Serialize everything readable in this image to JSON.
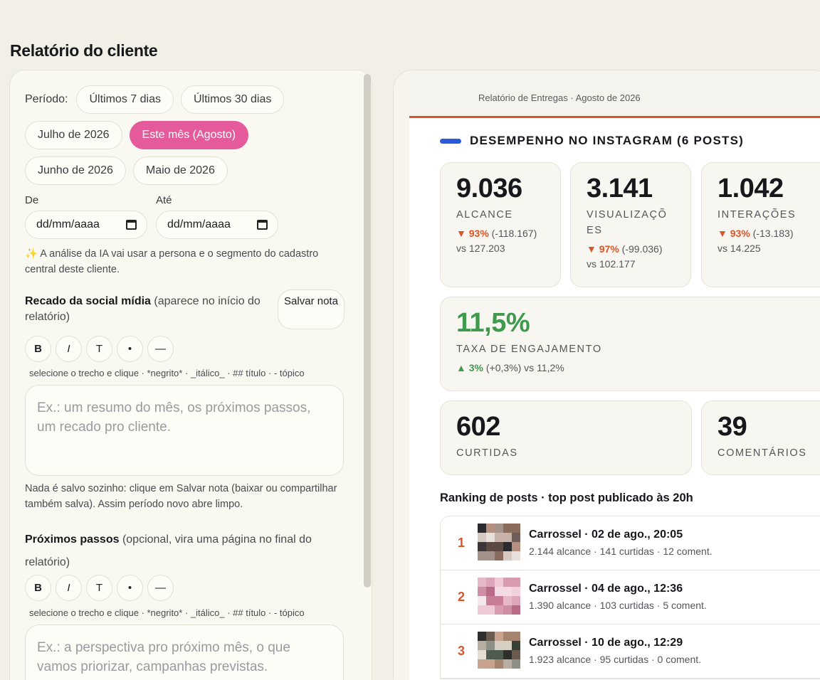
{
  "page_title": "Relatório do cliente",
  "period": {
    "label": "Período:",
    "options": [
      "Últimos 7 dias",
      "Últimos 30 dias",
      "Julho de 2026",
      "Este mês (Agosto)",
      "Junho de 2026",
      "Maio de 2026"
    ],
    "selected": "Este mês (Agosto)"
  },
  "date_range": {
    "from_label": "De",
    "to_label": "Até",
    "from_value": "dd/mm/aaaa",
    "to_value": "dd/mm/aaaa"
  },
  "ai_hint": "✨ A análise da IA vai usar a persona e o segmento do cadastro central deste cliente.",
  "note": {
    "title": "Recado da social mídia",
    "title_suffix": " (aparece no início do relatório)",
    "save_label": "Salvar nota",
    "format_buttons": [
      "B",
      "I",
      "T",
      "•",
      "—"
    ],
    "format_hint": "selecione o trecho e clique · *negrito* · _itálico_ · ## título · - tópico",
    "placeholder": "Ex.: um resumo do mês, os próximos passos, um recado pro cliente.",
    "save_hint": "Nada é salvo sozinho: clique em Salvar nota (baixar ou compartilhar também salva). Assim período novo abre limpo."
  },
  "next_steps": {
    "title": "Próximos passos",
    "title_suffix": " (opcional, vira uma página no final do relatório)",
    "format_buttons": [
      "B",
      "I",
      "T",
      "•",
      "—"
    ],
    "format_hint": "selecione o trecho e clique · *negrito* · _itálico_ · ## título · - tópico",
    "placeholder": "Ex.: a perspectiva pro próximo mês, o que vamos priorizar, campanhas previstas."
  },
  "report": {
    "header": "Relatório de Entregas · Agosto de 2026",
    "section_title": "DESEMPENHO NO INSTAGRAM (6 POSTS)",
    "accent_color": "#e0512b",
    "metrics": [
      {
        "value": "9.036",
        "caption": "ALCANCE",
        "delta_pct": "▼ 93%",
        "delta_abs": " (-118.167)",
        "vs": "vs 127.203",
        "trend": "down"
      },
      {
        "value": "3.141",
        "caption": "VISUALIZAÇÕES",
        "delta_pct": "▼ 97%",
        "delta_abs": " (-99.036)",
        "vs": "vs 102.177",
        "trend": "down"
      },
      {
        "value": "1.042",
        "caption": "INTERAÇÕES",
        "delta_pct": "▼ 93%",
        "delta_abs": " (-13.183)",
        "vs": "vs 14.225",
        "trend": "down"
      },
      {
        "value": "11,5%",
        "caption": "TAXA DE ENGAJAMENTO",
        "delta_pct": "▲ 3%",
        "delta_abs": " (+0,3%) vs 11,2%",
        "vs": "",
        "trend": "up"
      },
      {
        "value": "602",
        "caption": "CURTIDAS"
      },
      {
        "value": "39",
        "caption": "COMENTÁRIOS"
      }
    ],
    "ranking_title": "Ranking de posts · top post publicado às 20h",
    "ranking": [
      {
        "rank": "1",
        "title": "Carrossel · 02 de ago., 20:05",
        "meta": "2.144 alcance · 141 curtidas · 12 coment."
      },
      {
        "rank": "2",
        "title": "Carrossel · 04 de ago., 12:36",
        "meta": "1.390 alcance · 103 curtidas · 5 coment."
      },
      {
        "rank": "3",
        "title": "Carrossel · 10 de ago., 12:29",
        "meta": "1.923 alcance · 95 curtidas · 0 coment."
      }
    ]
  }
}
